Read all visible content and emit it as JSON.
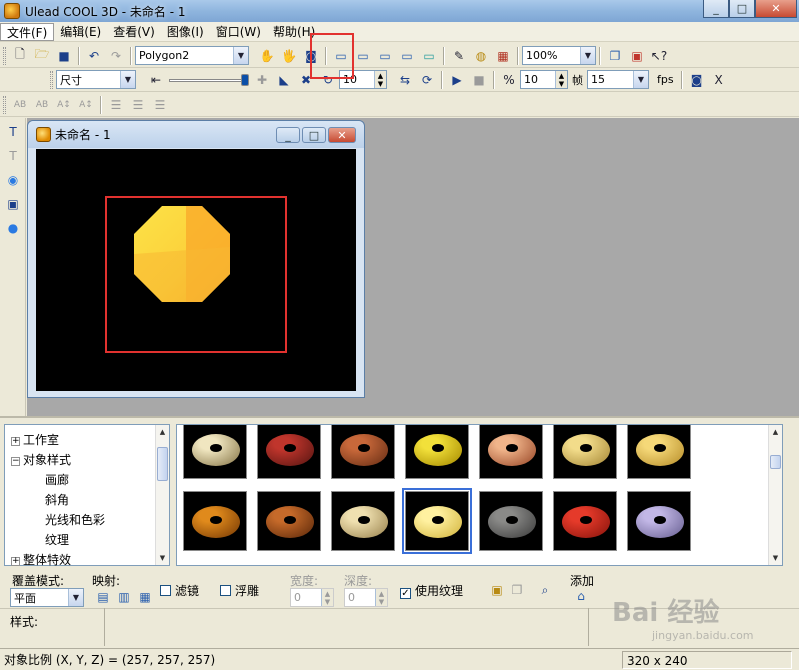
{
  "window": {
    "title": "Ulead COOL 3D - 未命名 - 1",
    "minimize": "_",
    "maximize": "□",
    "close": "✕"
  },
  "menu": [
    "文件(F)",
    "编辑(E)",
    "查看(V)",
    "图像(I)",
    "窗口(W)",
    "帮助(H)"
  ],
  "toolbar1": {
    "object_combo": "Polygon2",
    "zoom_combo": "100%"
  },
  "toolbar2": {
    "property_combo": "尺寸",
    "value1": "10",
    "value2": "10",
    "frame_label": "帧",
    "frame_value": "15",
    "fps_label": "fps"
  },
  "toolbar3": {
    "text_tools": [
      "AB",
      "AB",
      "A↕",
      "A↕"
    ]
  },
  "child_window": {
    "title": "未命名 - 1"
  },
  "tree": {
    "items": [
      {
        "label": "工作室",
        "expander": "+"
      },
      {
        "label": "对象样式",
        "expander": "−"
      },
      {
        "label": "画廊"
      },
      {
        "label": "斜角"
      },
      {
        "label": "光线和色彩"
      },
      {
        "label": "纹理"
      },
      {
        "label": "整体特效",
        "expander": "+"
      }
    ]
  },
  "textures": [
    "chrome",
    "brick-red",
    "brick-orange",
    "gold-yellow",
    "marble-pink",
    "wood-light",
    "wood-gold",
    "wood-dark",
    "wood-brown",
    "stone-tan",
    "gold-pale",
    "rock-gray",
    "scales-red",
    "mosaic-lavender"
  ],
  "texture_colors": [
    [
      "#f0e6c0",
      "#8b7a4c"
    ],
    [
      "#c0352c",
      "#5a1612"
    ],
    [
      "#c8683a",
      "#6a2f15"
    ],
    [
      "#f2e03a",
      "#a88d00"
    ],
    [
      "#f0b48a",
      "#9b4a2a"
    ],
    [
      "#f2dc8a",
      "#a88a38"
    ],
    [
      "#f5d878",
      "#b9902c"
    ],
    [
      "#e08a1c",
      "#7a3c05"
    ],
    [
      "#c66a2a",
      "#5f2a0a"
    ],
    [
      "#efe0b0",
      "#9c8550"
    ],
    [
      "#fff1a0",
      "#d4b640"
    ],
    [
      "#8a8a88",
      "#3e3e3e"
    ],
    [
      "#e53a2a",
      "#8c150d"
    ],
    [
      "#c2b7e6",
      "#6a6294"
    ]
  ],
  "selected_texture_index": 10,
  "options": {
    "overlay_mode_label": "覆盖模式:",
    "overlay_mode_value": "平面",
    "mapping_label": "映射:",
    "filter_label": "滤镜",
    "emboss_label": "浮雕",
    "width_label": "宽度:",
    "width_value": "0",
    "depth_label": "深度:",
    "depth_value": "0",
    "use_texture_label": "使用纹理",
    "use_texture_checked": "✓",
    "add_label": "添加"
  },
  "style": {
    "label": "样式:"
  },
  "status": {
    "ratio": "对象比例 (X, Y, Z) = (257, 257, 257)",
    "size": "320 x 240"
  },
  "watermark": {
    "brand": "Bai 经验",
    "url": "jingyan.baidu.com"
  },
  "colors": {
    "octagon_light": "#fde247",
    "octagon_dark": "#f6a21a",
    "highlight": "#e2322f"
  }
}
